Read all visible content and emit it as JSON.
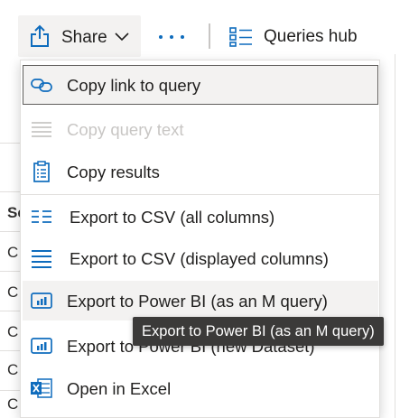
{
  "toolbar": {
    "share_label": "Share",
    "queries_hub_label": "Queries hub",
    "accent": "#0f6cbd"
  },
  "background": {
    "fragments": [
      "Se",
      "C",
      "C",
      "C",
      "C",
      "C"
    ]
  },
  "menu": {
    "items": [
      {
        "label": "Copy link to query",
        "icon": "link-icon",
        "state": "focused"
      },
      {
        "label": "Copy query text",
        "icon": "lines-icon",
        "state": "disabled"
      },
      {
        "label": "Copy results",
        "icon": "clipboard-icon",
        "state": "normal"
      },
      {
        "label": "Export to CSV (all columns)",
        "icon": "csv-all-columns-icon",
        "state": "normal"
      },
      {
        "label": "Export to CSV (displayed columns)",
        "icon": "csv-displayed-columns-icon",
        "state": "normal"
      },
      {
        "label": "Export to Power BI (as an M query)",
        "icon": "power-bi-icon",
        "state": "hover"
      },
      {
        "label": "Export to Power BI (new Dataset)",
        "icon": "power-bi-icon",
        "state": "normal"
      },
      {
        "label": "Open in Excel",
        "icon": "excel-icon",
        "state": "normal"
      }
    ]
  },
  "tooltip": {
    "text": "Export to Power BI (as an M query)"
  }
}
